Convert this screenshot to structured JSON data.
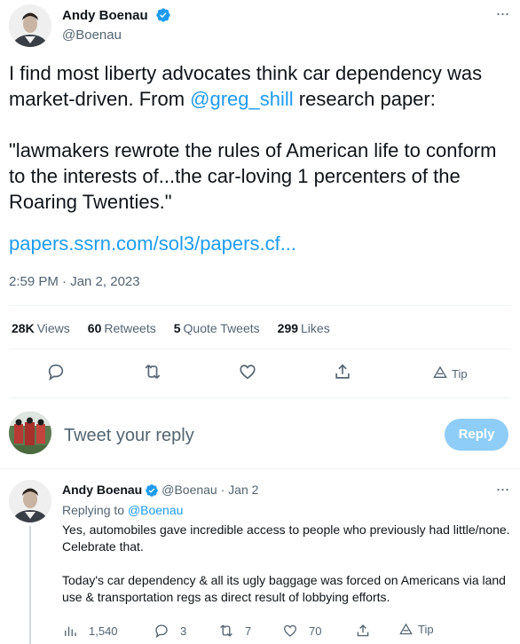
{
  "tweet": {
    "author": {
      "name": "Andy Boenau",
      "handle": "@Boenau"
    },
    "text": {
      "line1_pre": "I find most liberty advocates think car dependency was market-driven. From ",
      "mention": "@greg_shill",
      "line1_post": " research paper:",
      "quote": "\"lawmakers rewrote the rules of American life to conform to the interests of...the car-loving 1 percenters of the Roaring Twenties.\""
    },
    "link": "papers.ssrn.com/sol3/papers.cf...",
    "timestamp": "2:59 PM · Jan 2, 2023",
    "stats": {
      "views_count": "28K",
      "views_label": "Views",
      "retweets_count": "60",
      "retweets_label": "Retweets",
      "quotes_count": "5",
      "quotes_label": "Quote Tweets",
      "likes_count": "299",
      "likes_label": "Likes"
    },
    "actions": {
      "tip_label": "Tip"
    }
  },
  "reply_box": {
    "placeholder": "Tweet your reply",
    "button_label": "Reply"
  },
  "reply": {
    "author_name": "Andy Boenau",
    "handle": "@Boenau",
    "separator": "·",
    "date": "Jan 2",
    "replying_label": "Replying to",
    "replying_to": "@Boenau",
    "paragraph1": "Yes, automobiles gave incredible access to people who previously had little/none. Celebrate that.",
    "paragraph2": "Today's car dependency & all its ugly baggage was forced on Americans via land use & transportation regs as direct result of lobbying efforts.",
    "actions": {
      "views": "1,540",
      "replies": "3",
      "retweets": "7",
      "likes": "70",
      "tip_label": "Tip"
    }
  },
  "colors": {
    "accent": "#1d9bf0",
    "text_primary": "#0f1419",
    "text_secondary": "#536471",
    "reply_button_disabled": "#8ecdf8",
    "divider": "#eff3f4"
  }
}
